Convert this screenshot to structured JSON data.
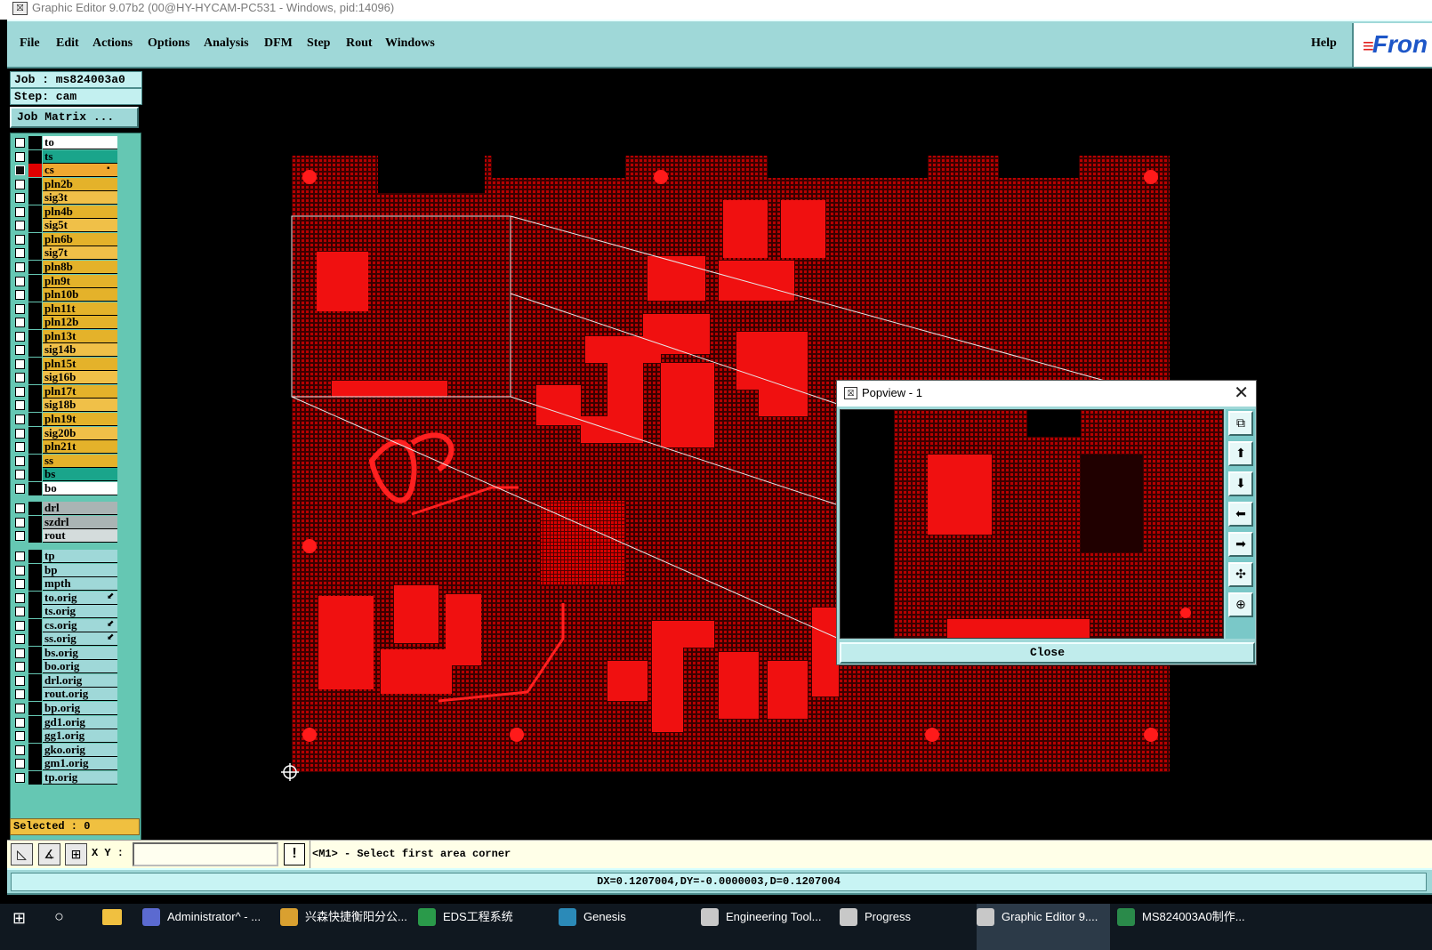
{
  "window": {
    "title": "Graphic Editor 9.07b2 (00@HY-HYCAM-PC531 - Windows, pid:14096)"
  },
  "menu": {
    "items": [
      "File",
      "Edit",
      "Actions",
      "Options",
      "Analysis",
      "DFM",
      "Step",
      "Rout",
      "Windows"
    ],
    "help": "Help",
    "brand": "Fron"
  },
  "left": {
    "job": "Job : ms824003a0",
    "step": "Step: cam",
    "job_matrix": "Job Matrix ...",
    "selected": "Selected : 0"
  },
  "layers": {
    "board": [
      {
        "name": "to",
        "color": "#ffffff"
      },
      {
        "name": "ts",
        "color": "#1aa58b"
      },
      {
        "name": "cs",
        "color": "#f0a830",
        "selected": true,
        "mark": "▪"
      },
      {
        "name": "pln2b",
        "color": "#e4b22a"
      },
      {
        "name": "sig3t",
        "color": "#f0c048"
      },
      {
        "name": "pln4b",
        "color": "#e4b22a"
      },
      {
        "name": "sig5t",
        "color": "#f0c048"
      },
      {
        "name": "pln6b",
        "color": "#e4b22a"
      },
      {
        "name": "sig7t",
        "color": "#f0c048"
      },
      {
        "name": "pln8b",
        "color": "#e4b22a"
      },
      {
        "name": "pln9t",
        "color": "#e4b22a"
      },
      {
        "name": "pln10b",
        "color": "#e4b22a"
      },
      {
        "name": "pln11t",
        "color": "#e4b22a"
      },
      {
        "name": "pln12b",
        "color": "#e4b22a"
      },
      {
        "name": "pln13t",
        "color": "#e4b22a"
      },
      {
        "name": "sig14b",
        "color": "#f0c048"
      },
      {
        "name": "pln15t",
        "color": "#e4b22a"
      },
      {
        "name": "sig16b",
        "color": "#f0c048"
      },
      {
        "name": "pln17t",
        "color": "#e4b22a"
      },
      {
        "name": "sig18b",
        "color": "#f0c048"
      },
      {
        "name": "pln19t",
        "color": "#e4b22a"
      },
      {
        "name": "sig20b",
        "color": "#f0c048"
      },
      {
        "name": "pln21t",
        "color": "#e4b22a"
      },
      {
        "name": "ss",
        "color": "#e4b22a"
      },
      {
        "name": "bs",
        "color": "#1aa58b"
      },
      {
        "name": "bo",
        "color": "#ffffff"
      }
    ],
    "drill": [
      {
        "name": "drl",
        "color": "#aab4b4"
      },
      {
        "name": "szdrl",
        "color": "#aab4b4"
      },
      {
        "name": "rout",
        "color": "#d4dcdc"
      }
    ],
    "misc": [
      {
        "name": "tp",
        "color": "#9fd8d8"
      },
      {
        "name": "bp",
        "color": "#9fd8d8"
      },
      {
        "name": "mpth",
        "color": "#9fd8d8"
      },
      {
        "name": "to.orig",
        "color": "#9fd8d8",
        "mark": "⬋"
      },
      {
        "name": "ts.orig",
        "color": "#9fd8d8"
      },
      {
        "name": "cs.orig",
        "color": "#9fd8d8",
        "mark": "⬋"
      },
      {
        "name": "ss.orig",
        "color": "#9fd8d8",
        "mark": "⬋"
      },
      {
        "name": "bs.orig",
        "color": "#9fd8d8"
      },
      {
        "name": "bo.orig",
        "color": "#9fd8d8"
      },
      {
        "name": "drl.orig",
        "color": "#9fd8d8"
      },
      {
        "name": "rout.orig",
        "color": "#9fd8d8"
      },
      {
        "name": "bp.orig",
        "color": "#9fd8d8"
      },
      {
        "name": "gd1.orig",
        "color": "#9fd8d8"
      },
      {
        "name": "gg1.orig",
        "color": "#9fd8d8"
      },
      {
        "name": "gko.orig",
        "color": "#9fd8d8"
      },
      {
        "name": "gm1.orig",
        "color": "#9fd8d8"
      },
      {
        "name": "tp.orig",
        "color": "#9fd8d8"
      }
    ]
  },
  "command": {
    "xy_label": "X Y :",
    "xy_value": "",
    "prompt": "<M1> - Select first area corner"
  },
  "status": {
    "text": "DX=0.1207004,DY=-0.0000003,D=0.1207004"
  },
  "popview": {
    "title": "Popview - 1",
    "close_label": "Close",
    "tools": [
      "zoom-fit-icon",
      "pan-up-icon",
      "pan-down-icon",
      "pan-left-icon",
      "pan-right-icon",
      "zoom-home-icon",
      "zoom-center-icon"
    ]
  },
  "taskbar": {
    "items": [
      {
        "label": "Administrator^ - ...",
        "icon": "disk-icon"
      },
      {
        "label": "兴森快捷衡阳分公...",
        "icon": "browser-icon"
      },
      {
        "label": "EDS工程系统",
        "icon": "eds-icon"
      },
      {
        "label": "Genesis",
        "icon": "genesis-icon"
      },
      {
        "label": "Engineering Tool...",
        "icon": "tool-icon"
      },
      {
        "label": "Progress",
        "icon": "progress-icon"
      },
      {
        "label": "Graphic Editor 9....",
        "icon": "editor-icon",
        "active": true
      },
      {
        "label": "MS824003A0制作...",
        "icon": "excel-icon"
      }
    ]
  },
  "colors": {
    "board_copper": "#e00000",
    "panel_teal": "#9fd8d8",
    "layer_panel": "#65c7b3",
    "layer_signal": "#e4b22a"
  }
}
